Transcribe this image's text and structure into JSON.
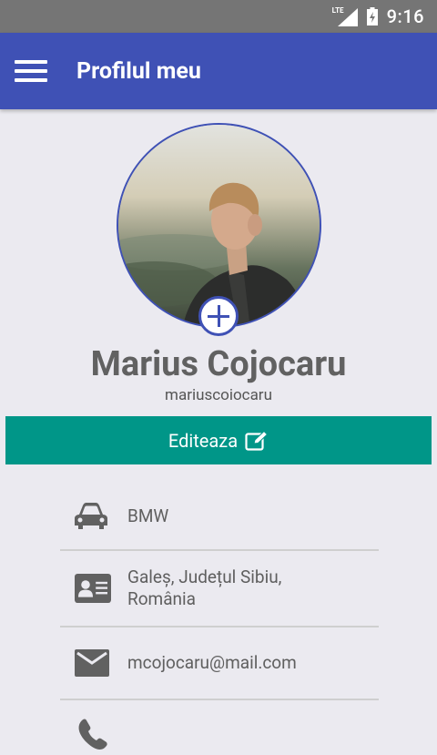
{
  "status_bar": {
    "network_label": "LTE",
    "time": "9:16"
  },
  "app_bar": {
    "title": "Profilul meu"
  },
  "profile": {
    "name": "Marius Cojocaru",
    "username": "mariuscoiocaru"
  },
  "edit_button": {
    "label": "Editeaza"
  },
  "info": {
    "car": "BMW",
    "address_line1": "Galeș, Județul Sibiu,",
    "address_line2": "România",
    "email": "mcojocaru@mail.com"
  },
  "colors": {
    "app_bar": "#3f51b5",
    "edit_button": "#009688",
    "status_bar": "#757575",
    "background": "#ebeaf0"
  },
  "icons": [
    "menu-icon",
    "car-icon",
    "contact-card-icon",
    "mail-icon",
    "phone-icon",
    "edit-icon",
    "add-photo-icon"
  ]
}
